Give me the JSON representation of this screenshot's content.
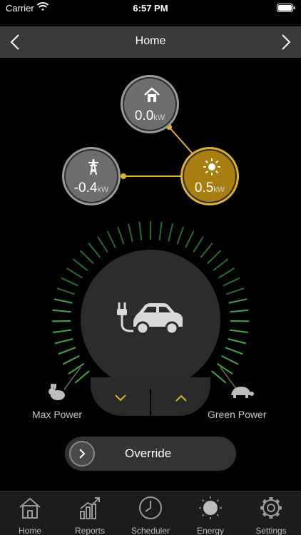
{
  "status": {
    "carrier": "Carrier",
    "time": "6:57 PM"
  },
  "nav": {
    "title": "Home"
  },
  "nodes": {
    "home": {
      "value": "0.0",
      "unit": "kW"
    },
    "grid": {
      "value": "-0.4",
      "unit": "kW"
    },
    "solar": {
      "value": "0.5",
      "unit": "kW"
    }
  },
  "controls": {
    "max_power": "Max Power",
    "green_power": "Green Power",
    "override": "Override"
  },
  "tabs": [
    {
      "label": "Home"
    },
    {
      "label": "Reports"
    },
    {
      "label": "Scheduler"
    },
    {
      "label": "Energy"
    },
    {
      "label": "Settings"
    }
  ],
  "colors": {
    "solar": "#e0b030",
    "gauge_green": "#3fa84a",
    "gauge_dim": "#2a6b31"
  }
}
